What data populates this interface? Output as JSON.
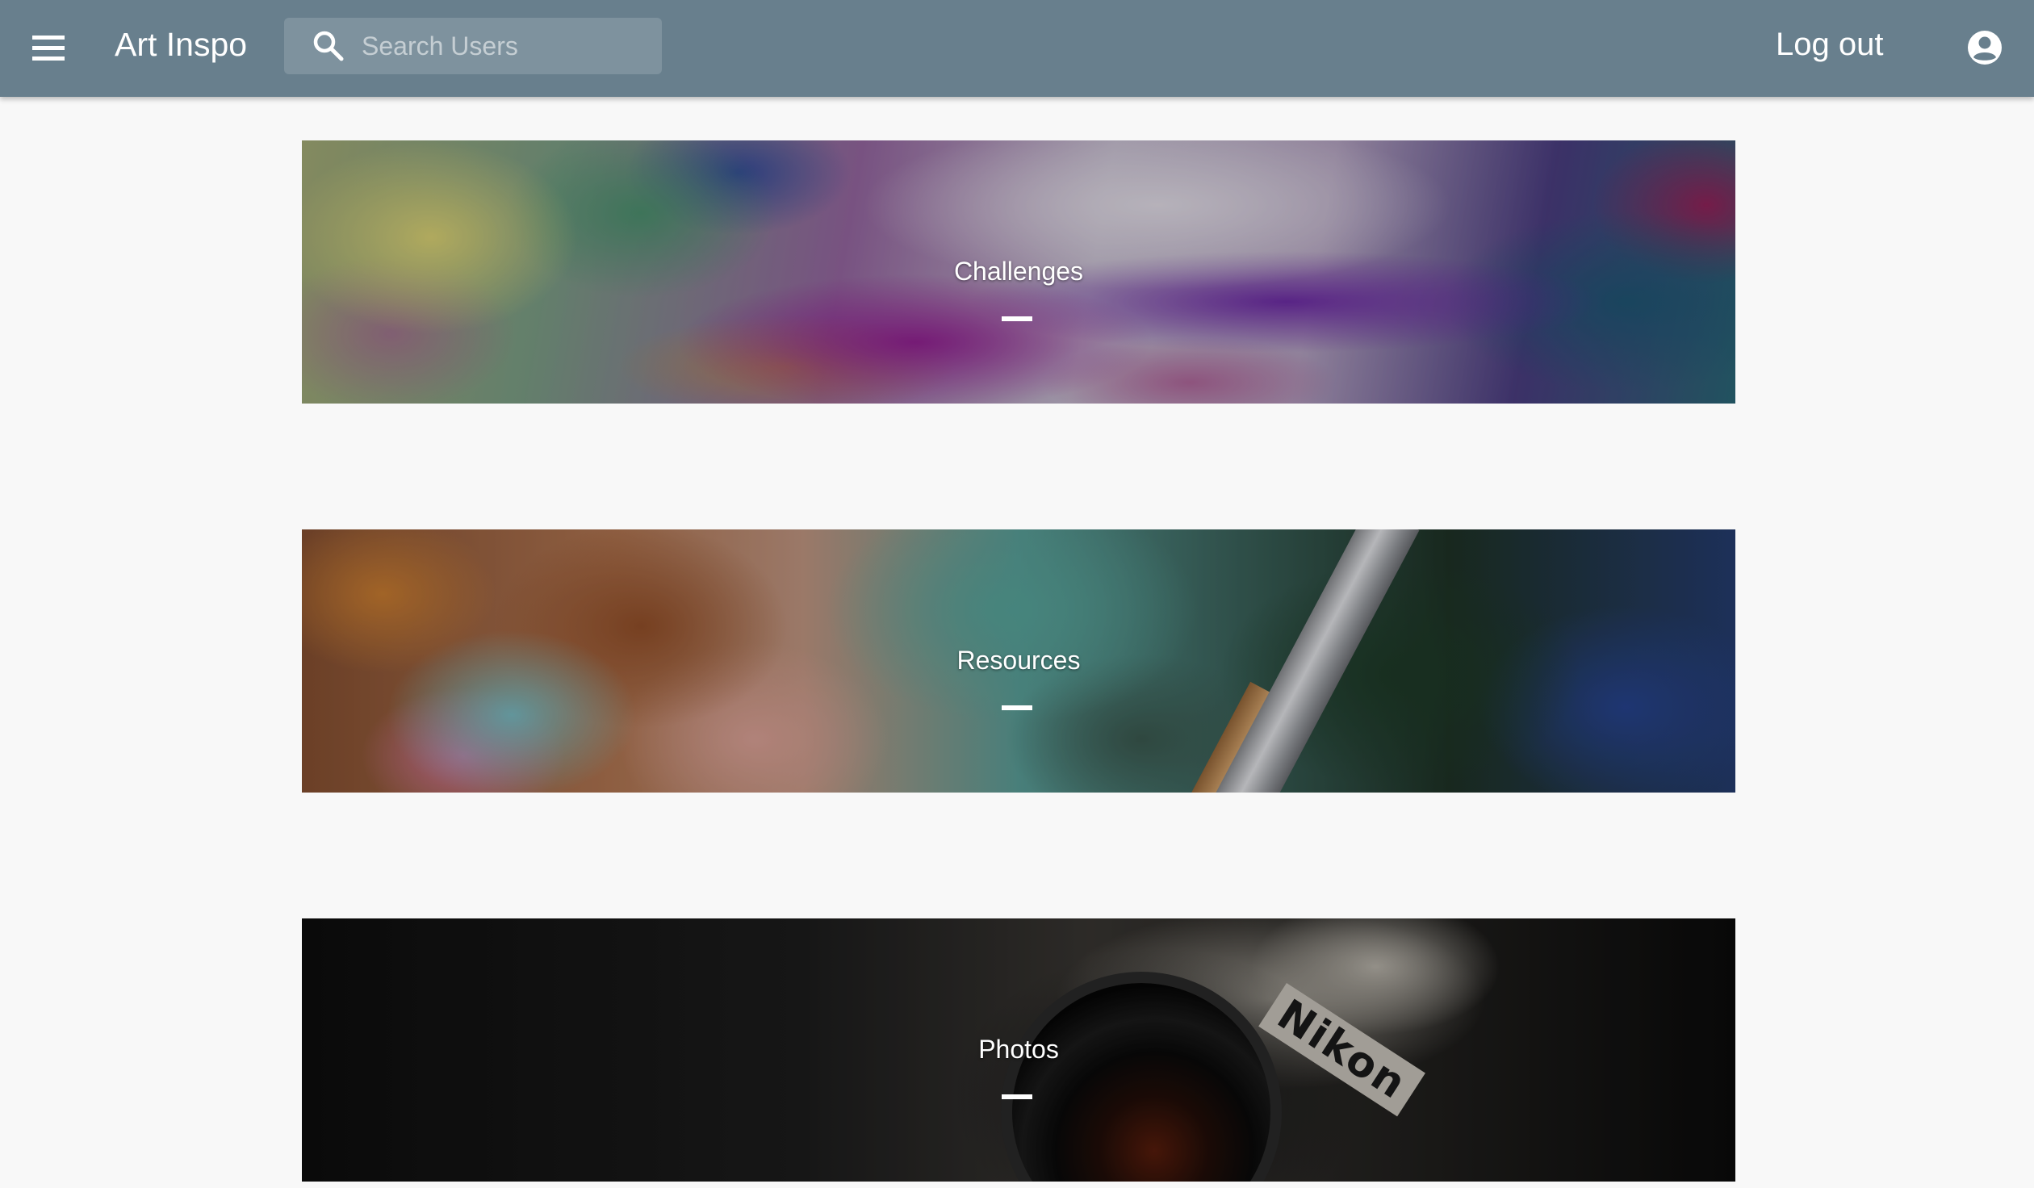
{
  "header": {
    "app_title": "Art Inspo",
    "search_placeholder": "Search Users",
    "logout_label": "Log out",
    "background_color": "#687f8d"
  },
  "icons": {
    "menu": "menu-icon",
    "search": "search-icon",
    "account": "account-circle-icon"
  },
  "cards": [
    {
      "label": "Challenges"
    },
    {
      "label": "Resources"
    },
    {
      "label": "Photos",
      "image_text": "Nikon"
    }
  ]
}
